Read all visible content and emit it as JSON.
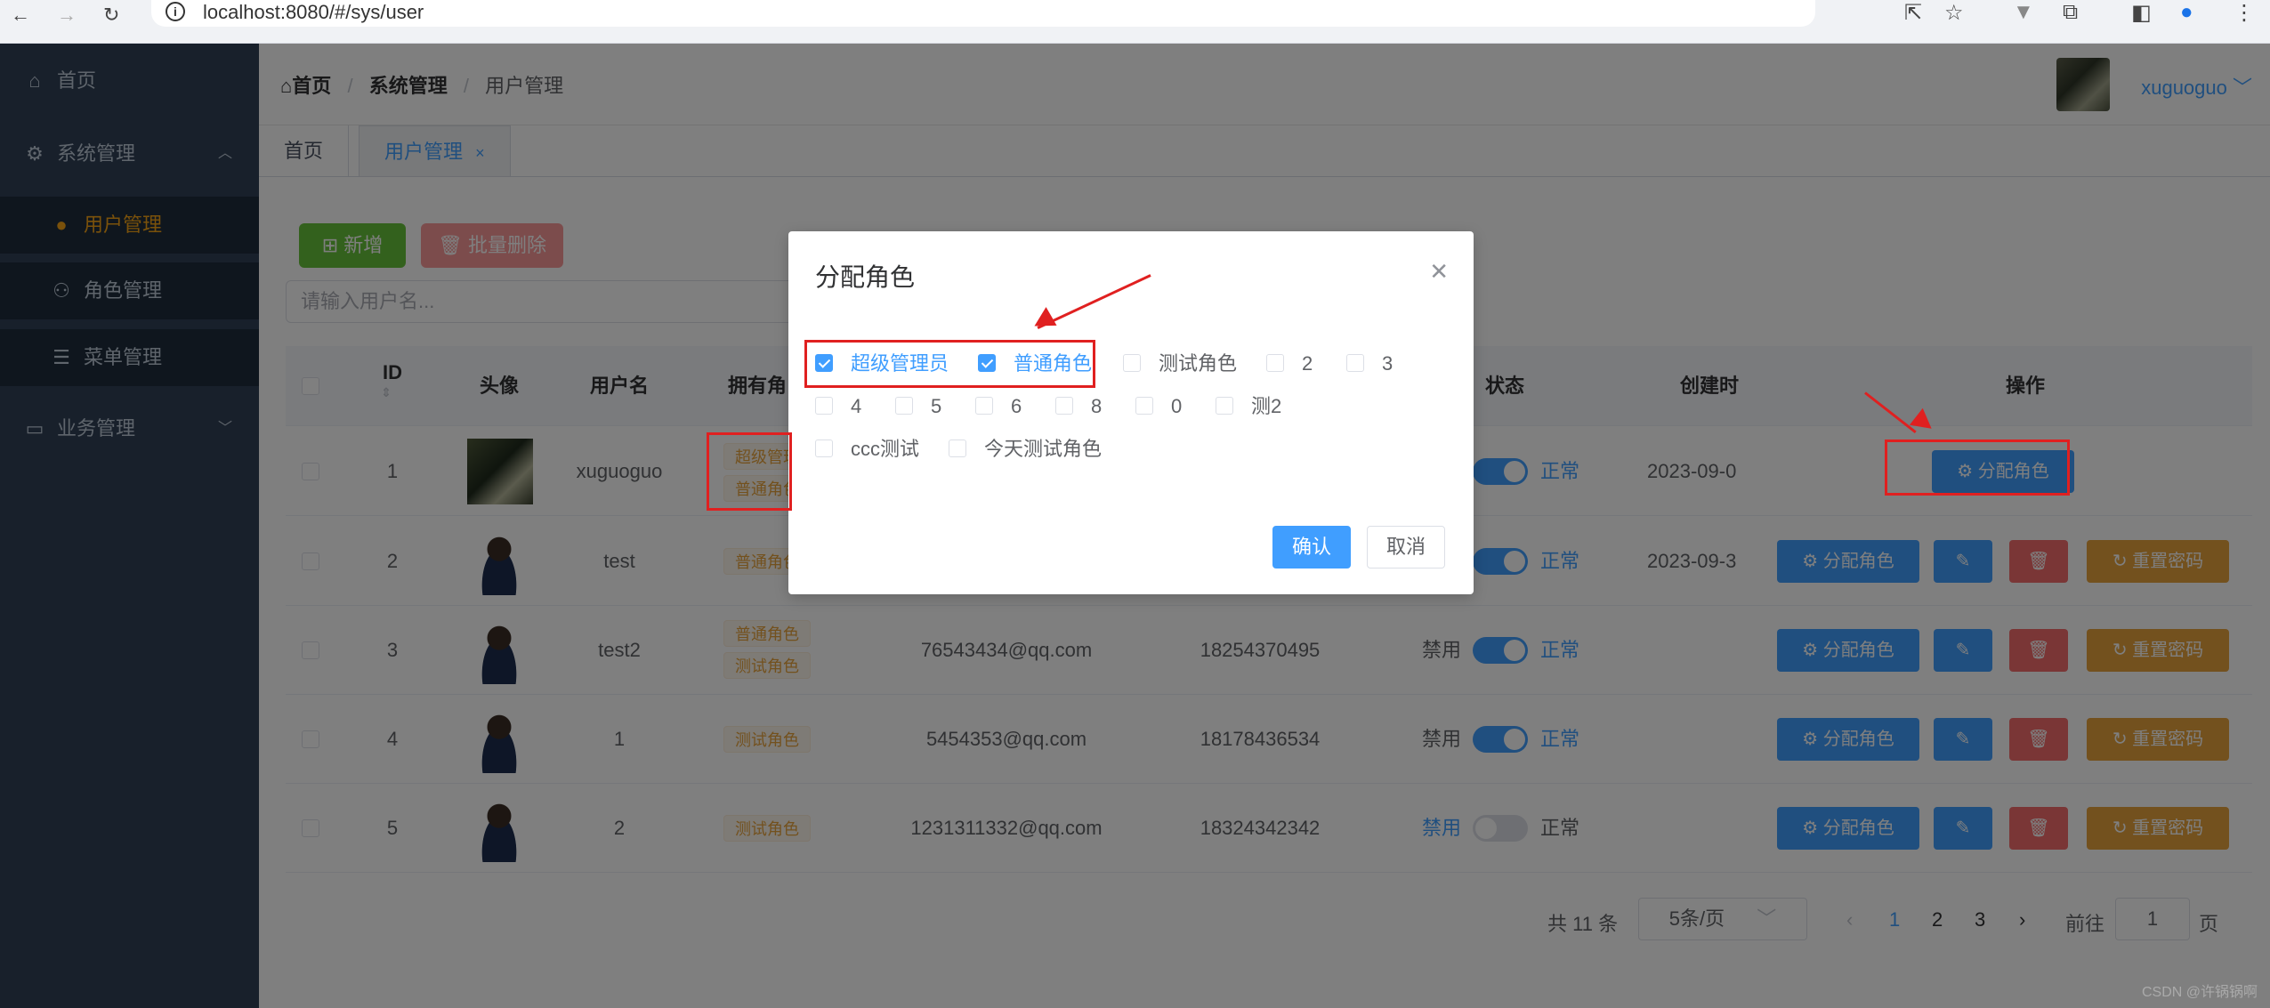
{
  "browser": {
    "url": "localhost:8080/#/sys/user",
    "back_icon": "←",
    "forward_icon": "→",
    "reload_icon": "↻"
  },
  "sidebar": {
    "items": [
      {
        "label": "首页",
        "icon": "home-icon"
      },
      {
        "label": "系统管理",
        "icon": "gear-icon"
      },
      {
        "label": "用户管理",
        "icon": "user-icon"
      },
      {
        "label": "角色管理",
        "icon": "users-icon"
      },
      {
        "label": "菜单管理",
        "icon": "menu-icon"
      },
      {
        "label": "业务管理",
        "icon": "monitor-icon"
      }
    ]
  },
  "header": {
    "breadcrumb": [
      "首页",
      "系统管理",
      "用户管理"
    ],
    "username": "xuguoguo"
  },
  "tabs": [
    {
      "label": "首页"
    },
    {
      "label": "用户管理"
    }
  ],
  "toolbar": {
    "add_label": "新增",
    "batch_delete_label": "批量删除",
    "search_placeholder": "请输入用户名..."
  },
  "table": {
    "columns": [
      "ID",
      "头像",
      "用户名",
      "拥有角",
      "状态",
      "创建时",
      "操作"
    ],
    "rows": [
      {
        "id": "1",
        "username": "xuguoguo",
        "roles": [
          "超级管理",
          "普通角色"
        ],
        "email": "",
        "phone": "",
        "status_off": "",
        "status_on": "正常",
        "created": "2023-09-0",
        "enabled": true
      },
      {
        "id": "2",
        "username": "test",
        "roles": [
          "普通角色"
        ],
        "email": "",
        "phone": "",
        "status_off": "",
        "status_on": "正常",
        "created": "2023-09-3",
        "enabled": true
      },
      {
        "id": "3",
        "username": "test2",
        "roles": [
          "普通角色",
          "测试角色"
        ],
        "email": "76543434@qq.com",
        "phone": "18254370495",
        "status_off": "禁用",
        "status_on": "正常",
        "created": "",
        "enabled": true
      },
      {
        "id": "4",
        "username": "1",
        "roles": [
          "测试角色"
        ],
        "email": "5454353@qq.com",
        "phone": "18178436534",
        "status_off": "禁用",
        "status_on": "正常",
        "created": "",
        "enabled": true
      },
      {
        "id": "5",
        "username": "2",
        "roles": [
          "测试角色"
        ],
        "email": "1231311332@qq.com",
        "phone": "18324342342",
        "status_off": "禁用",
        "status_on": "正常",
        "created": "",
        "enabled": false
      }
    ],
    "op_assign_label": "分配角色",
    "op_reset_label": "重置密码"
  },
  "pagination": {
    "total": "共 11 条",
    "page_size": "5条/页",
    "pages": [
      "1",
      "2",
      "3"
    ],
    "goto_label": "前往",
    "goto_value": "1",
    "page_unit": "页"
  },
  "dialog": {
    "title": "分配角色",
    "roles": [
      {
        "label": "超级管理员",
        "checked": true
      },
      {
        "label": "普通角色",
        "checked": true
      },
      {
        "label": "测试角色",
        "checked": false
      },
      {
        "label": "2",
        "checked": false
      },
      {
        "label": "3",
        "checked": false
      },
      {
        "label": "4",
        "checked": false
      },
      {
        "label": "5",
        "checked": false
      },
      {
        "label": "6",
        "checked": false
      },
      {
        "label": "8",
        "checked": false
      },
      {
        "label": "0",
        "checked": false
      },
      {
        "label": "测2",
        "checked": false
      },
      {
        "label": "ccc测试",
        "checked": false
      },
      {
        "label": "今天测试角色",
        "checked": false
      }
    ],
    "confirm_label": "确认",
    "cancel_label": "取消"
  },
  "watermark": "CSDN @许锅锅啊",
  "colors": {
    "primary": "#409eff",
    "sidebar_bg": "#304156",
    "active_menu": "#f4a316",
    "annotation_red": "#e02020"
  }
}
